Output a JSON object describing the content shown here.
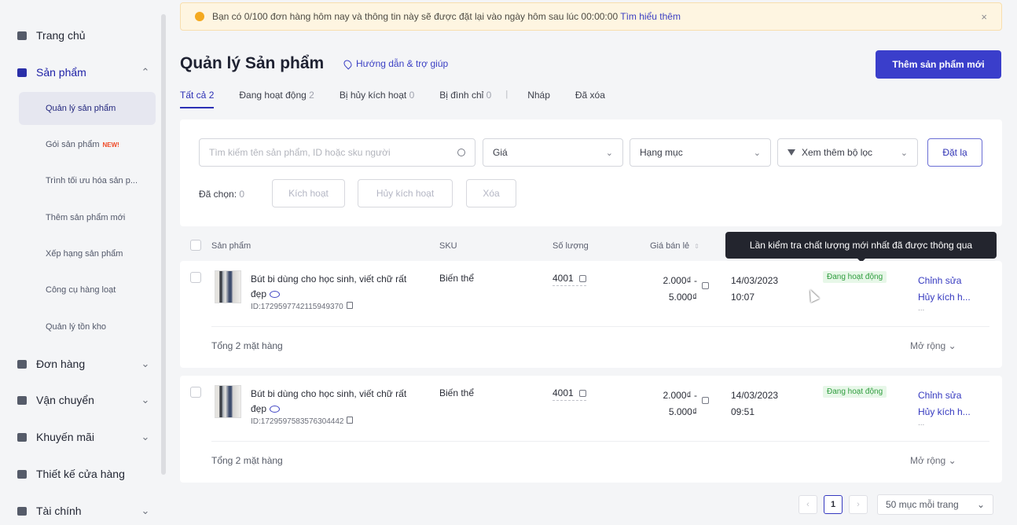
{
  "sidebar": {
    "items": [
      {
        "label": "Trang chủ",
        "chev": ""
      },
      {
        "label": "Sản phẩm",
        "chev": "⌃"
      },
      {
        "label": "Đơn hàng",
        "chev": "⌄"
      },
      {
        "label": "Vận chuyển",
        "chev": "⌄"
      },
      {
        "label": "Khuyến mãi",
        "chev": "⌄"
      },
      {
        "label": "Thiết kế cửa hàng",
        "chev": ""
      },
      {
        "label": "Tài chính",
        "chev": "⌄"
      }
    ],
    "sub_items": [
      {
        "label": "Quản lý sản phẩm"
      },
      {
        "label": "Gói sản phẩm",
        "tag": "NEW!"
      },
      {
        "label": "Trình tối ưu hóa sản p..."
      },
      {
        "label": "Thêm sản phẩm mới"
      },
      {
        "label": "Xếp hạng sản phẩm"
      },
      {
        "label": "Công cụ hàng loạt"
      },
      {
        "label": "Quản lý tồn kho"
      }
    ]
  },
  "banner": {
    "text": "Bạn có 0/100 đơn hàng hôm nay và thông tin này sẽ được đặt lại vào ngày hôm sau lúc 00:00:00",
    "link": "Tìm hiểu thêm",
    "close": "×"
  },
  "header": {
    "title": "Quản lý Sản phẩm",
    "guide": "Hướng dẫn & trợ giúp",
    "add_button": "Thêm sản phẩm mới"
  },
  "tabs": [
    {
      "label": "Tất cả",
      "count": "2"
    },
    {
      "label": "Đang hoạt động",
      "count": "2"
    },
    {
      "label": "Bị hủy kích hoạt",
      "count": "0"
    },
    {
      "label": "Bị đình chỉ",
      "count": "0"
    },
    {
      "label": "Nháp",
      "count": ""
    },
    {
      "label": "Đã xóa",
      "count": ""
    }
  ],
  "tab_separator": "|",
  "filters": {
    "search_placeholder": "Tìm kiếm tên sản phẩm, ID hoặc sku người",
    "price": "Giá",
    "category": "Hạng mục",
    "more": "Xem thêm bộ lọc",
    "reset": "Đặt lạ",
    "selected_label": "Đã chọn:",
    "selected_count": "0",
    "activate": "Kích hoạt",
    "deactivate": "Hủy kích hoạt",
    "delete": "Xóa"
  },
  "table": {
    "headers": {
      "product": "Sản phẩm",
      "sku": "SKU",
      "qty": "Số lượng",
      "price": "Giá bán lẻ"
    }
  },
  "tooltip": "Lần kiểm tra chất lượng mới nhất đã được thông qua",
  "products": [
    {
      "name": "Bút bi dùng cho học sinh, viết chữ rất đẹp",
      "id": "ID:1729597742115949370",
      "sku": "Biến thể",
      "qty": "4001",
      "price_min": "2.000₫ -",
      "price_max": "5.000₫",
      "date": "14/03/2023",
      "time": "10:07",
      "status": "Đang hoạt động",
      "edit": "Chỉnh sửa",
      "deactivate": "Hủy kích h...",
      "more": "...",
      "total": "Tổng 2 mặt hàng",
      "expand": "Mở rộng"
    },
    {
      "name": "Bút bi dùng cho học sinh, viết chữ rất đẹp",
      "id": "ID:1729597583576304442",
      "sku": "Biến thể",
      "qty": "4001",
      "price_min": "2.000₫ -",
      "price_max": "5.000₫",
      "date": "14/03/2023",
      "time": "09:51",
      "status": "Đang hoạt động",
      "edit": "Chỉnh sửa",
      "deactivate": "Hủy kích h...",
      "more": "...",
      "total": "Tổng 2 mặt hàng",
      "expand": "Mở rộng"
    }
  ],
  "pagination": {
    "prev": "‹",
    "current": "1",
    "next": "›",
    "per_page": "50 mục mỗi trang",
    "chev": "⌄"
  },
  "colors": {
    "accent": "#3a3ecb",
    "status_green": "#2f9d3e",
    "banner_bg": "#fef5e1"
  }
}
